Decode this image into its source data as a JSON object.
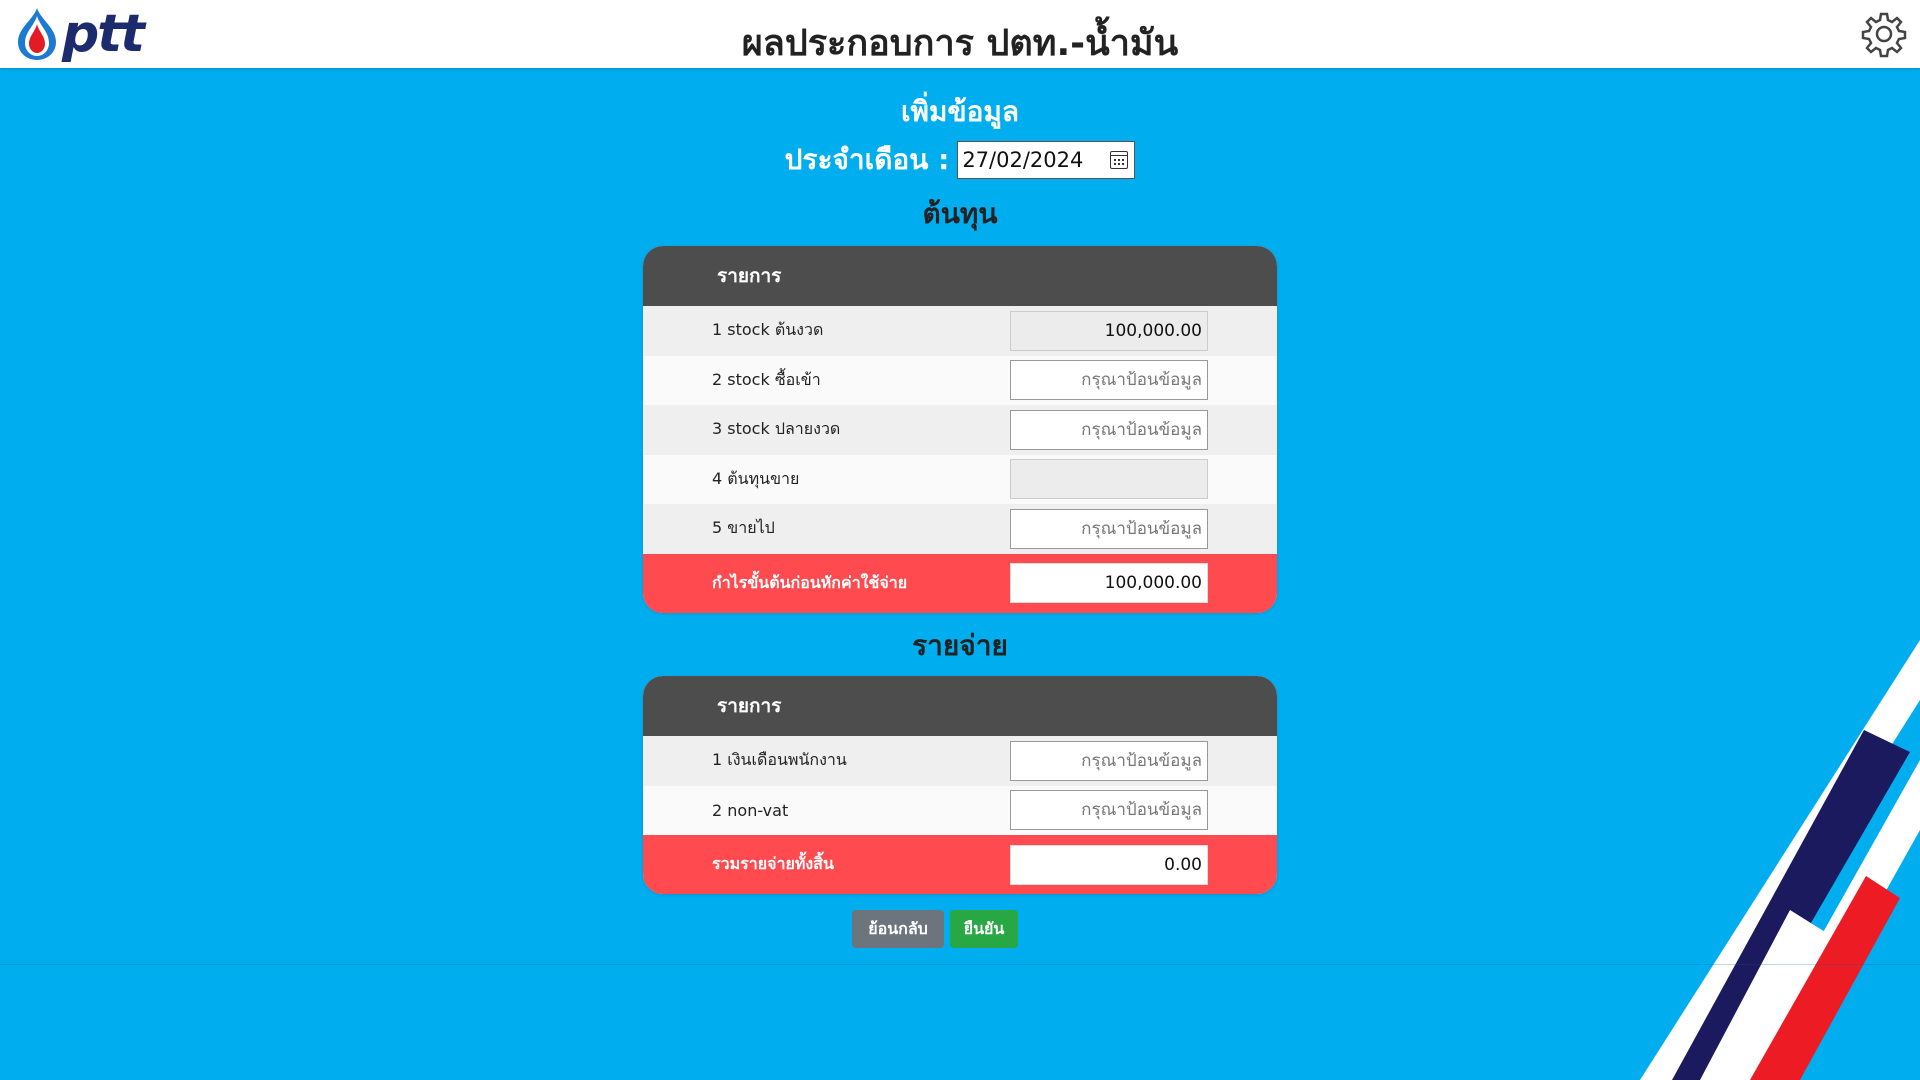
{
  "header": {
    "logo_text": "ptt",
    "title": "ผลประกอบการ ปตท.-น้ำมัน"
  },
  "form": {
    "heading": "เพิ่มข้อมูล",
    "month_label": "ประจำเดือน :",
    "date_value": "27/02/2024"
  },
  "cost": {
    "heading": "ต้นทุน",
    "column_header": "รายการ",
    "rows": [
      {
        "label": "1 stock ต้นงวด",
        "value": "100,000.00",
        "placeholder": ""
      },
      {
        "label": "2 stock ซื้อเข้า",
        "value": "",
        "placeholder": "กรุณาป้อนข้อมูล"
      },
      {
        "label": "3 stock ปลายงวด",
        "value": "",
        "placeholder": "กรุณาป้อนข้อมูล"
      },
      {
        "label": "4 ต้นทุนขาย",
        "value": "",
        "placeholder": ""
      },
      {
        "label": "5 ขายไป",
        "value": "",
        "placeholder": "กรุณาป้อนข้อมูล"
      }
    ],
    "total_label": "กำไรขั้นต้นก่อนหักค่าใช้จ่าย",
    "total_value": "100,000.00"
  },
  "expense": {
    "heading": "รายจ่าย",
    "column_header": "รายการ",
    "rows": [
      {
        "label": "1 เงินเดือนพนักงาน",
        "value": "",
        "placeholder": "กรุณาป้อนข้อมูล"
      },
      {
        "label": "2 non-vat",
        "value": "",
        "placeholder": "กรุณาป้อนข้อมูล"
      }
    ],
    "total_label": "รวมรายจ่ายทั้งสิ้น",
    "total_value": "0.00"
  },
  "buttons": {
    "back": "ย้อนกลับ",
    "confirm": "ยืนยัน"
  },
  "icons": {
    "logo": "ptt-flame-logo-icon",
    "settings": "gear-icon",
    "calendar": "calendar-icon"
  },
  "colors": {
    "background": "#00aeef",
    "header_bg": "#ffffff",
    "table_head": "#4d4d4d",
    "total_row": "#ff4a4f",
    "back_button": "#6c757d",
    "confirm_button": "#28a745",
    "stripe_navy": "#1c1a5e",
    "stripe_red": "#ed1c24"
  }
}
